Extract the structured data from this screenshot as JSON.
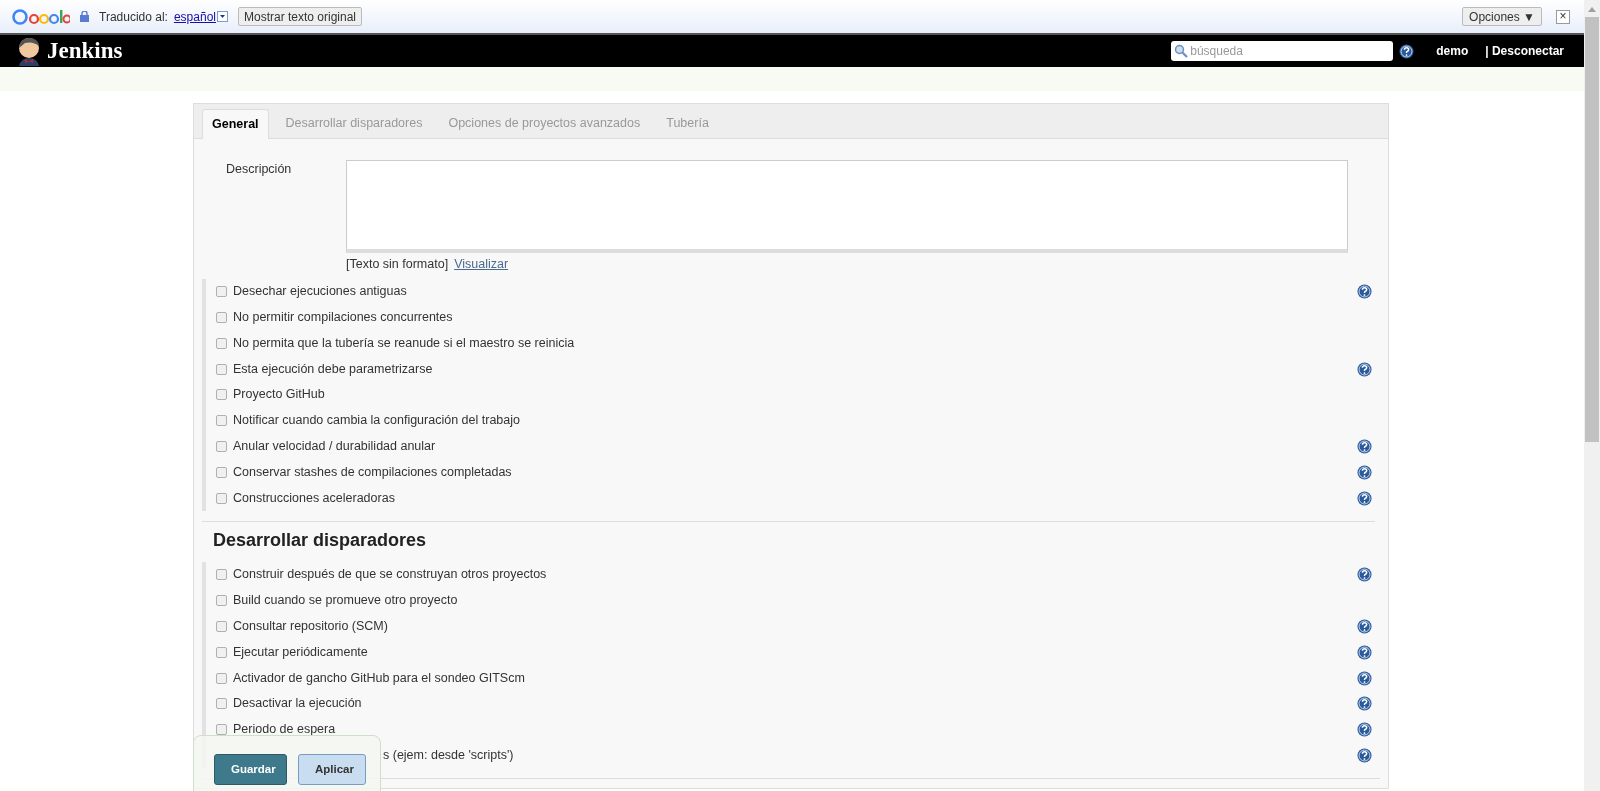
{
  "translate_bar": {
    "label": "Traducido al:",
    "language": "español",
    "show_original": "Mostrar texto original",
    "options": "Opciones ▼",
    "close": "×"
  },
  "header": {
    "title": "Jenkins",
    "search": {
      "placeholder": "búsqueda"
    },
    "user": "demo",
    "logout": "| Desconectar"
  },
  "tabs": [
    {
      "label": "General",
      "selected": true
    },
    {
      "label": "Desarrollar disparadores",
      "selected": false
    },
    {
      "label": "Opciones de proyectos avanzados",
      "selected": false
    },
    {
      "label": "Tubería",
      "selected": false
    }
  ],
  "description": {
    "label": "Descripción",
    "format": "[Texto sin formato]",
    "preview": "Visualizar"
  },
  "sections": [
    {
      "options": [
        {
          "label": "Desechar ejecuciones antiguas",
          "checked": false,
          "help": true
        },
        {
          "label": "No permitir compilaciones concurrentes",
          "checked": false,
          "help": false
        },
        {
          "label": "No permita que la tubería se reanude si el maestro se reinicia",
          "checked": false,
          "help": false
        },
        {
          "label": "Esta ejecución debe parametrizarse",
          "checked": false,
          "help": true
        },
        {
          "label": "Proyecto GitHub",
          "checked": false,
          "help": false
        },
        {
          "label": "Notificar cuando cambia la configuración del trabajo",
          "checked": false,
          "help": false
        },
        {
          "label": "Anular velocidad / durabilidad anular",
          "checked": false,
          "help": true
        },
        {
          "label": "Conservar stashes de compilaciones completadas",
          "checked": false,
          "help": true
        },
        {
          "label": "Construcciones aceleradoras",
          "checked": false,
          "help": true
        }
      ]
    },
    {
      "title": "Desarrollar disparadores",
      "options": [
        {
          "label": "Construir después de que se construyan otros proyectos",
          "checked": false,
          "help": true
        },
        {
          "label": "Build cuando se promueve otro proyecto",
          "checked": false,
          "help": false
        },
        {
          "label": "Consultar repositorio (SCM)",
          "checked": false,
          "help": true
        },
        {
          "label": "Ejecutar periódicamente",
          "checked": false,
          "help": true
        },
        {
          "label": "Activador de gancho GitHub para el sondeo GITScm",
          "checked": false,
          "help": true
        },
        {
          "label": "Desactivar la ejecución",
          "checked": false,
          "help": true
        },
        {
          "label": "Periodo de espera",
          "checked": false,
          "help": true
        },
        {
          "label": "s (ejem: desde 'scripts')",
          "help": true,
          "covered": true
        }
      ]
    }
  ],
  "actions": [
    {
      "label": "Guardar",
      "kind": "primary"
    },
    {
      "label": "Aplicar",
      "kind": "secondary"
    }
  ]
}
